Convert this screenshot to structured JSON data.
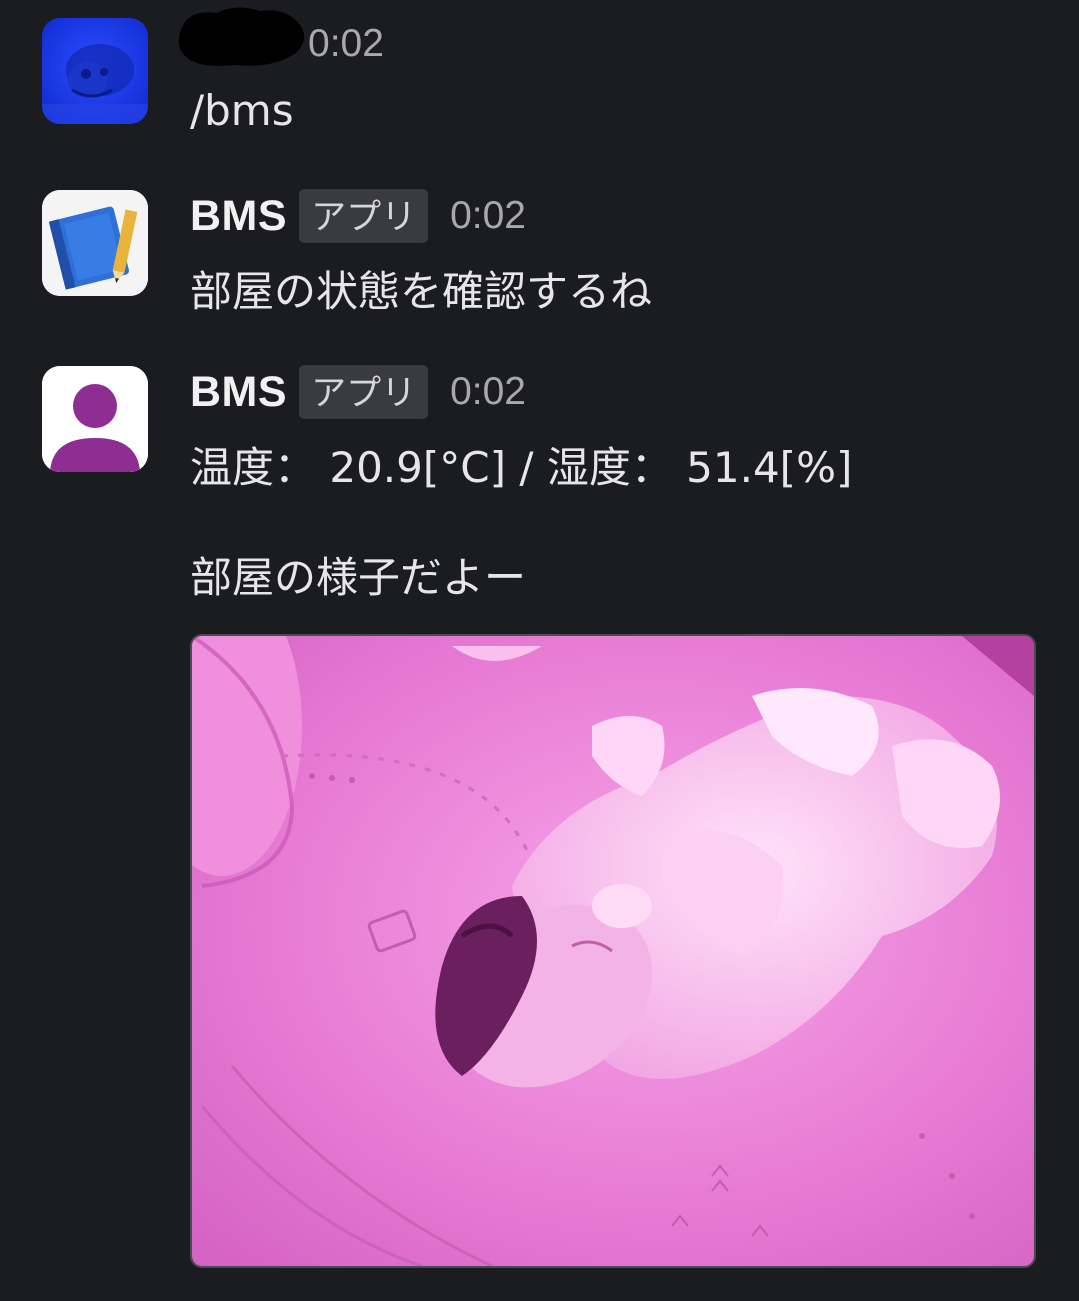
{
  "messages": [
    {
      "sender": "",
      "time": "0:02",
      "text": "/bms",
      "avatar_icon": "fish-photo-avatar-icon",
      "avatar_color": "#1a3fd8"
    },
    {
      "sender": "BMS",
      "badge": "アプリ",
      "time": "0:02",
      "text": "部屋の状態を確認するね",
      "avatar_icon": "notebook-pencil-icon",
      "avatar_color": "#2f6fd8"
    },
    {
      "sender": "BMS",
      "badge": "アプリ",
      "time": "0:02",
      "text": "温度： 20.9[°C] / 湿度： 51.4[%]",
      "text2": "部屋の様子だよー",
      "avatar_icon": "default-user-icon",
      "avatar_color": "#8e2e92",
      "attachment": "infrared-camera-photo-icon",
      "attachment_tint": "#d968c8"
    }
  ]
}
